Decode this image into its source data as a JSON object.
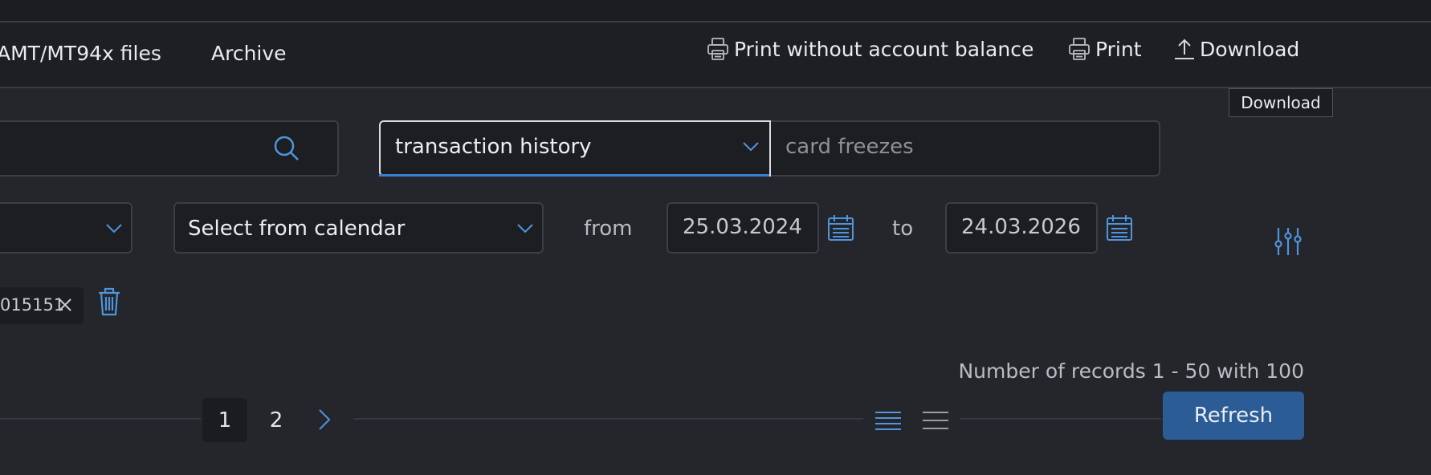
{
  "toolbar": {
    "tabs": [
      {
        "label": "AMT/MT94x files"
      },
      {
        "label": "Archive"
      }
    ],
    "actions": {
      "print_without_balance": "Print without account balance",
      "print": "Print",
      "download": "Download"
    },
    "tooltip": "Download"
  },
  "search": {
    "value": "",
    "icon": "search-icon"
  },
  "filter": {
    "type_selected": "transaction history",
    "query_placeholder": "card freezes"
  },
  "period": {
    "first_select_value": "",
    "calendar_select": "Select from calendar",
    "from_label": "from",
    "from_date": "25.03.2024",
    "to_label": "to",
    "to_date": "24.03.2026"
  },
  "tags": [
    {
      "label": "015151"
    }
  ],
  "results": {
    "records_text": "Number of records 1 - 50 with 100",
    "pages": [
      "1",
      "2"
    ],
    "current_page": "1",
    "refresh_label": "Refresh"
  },
  "colors": {
    "background": "#24262b",
    "toolbar": "#1d1f23",
    "accent": "#3a7fcf",
    "icon_blue": "#4f95dd",
    "button": "#2b5c95"
  }
}
